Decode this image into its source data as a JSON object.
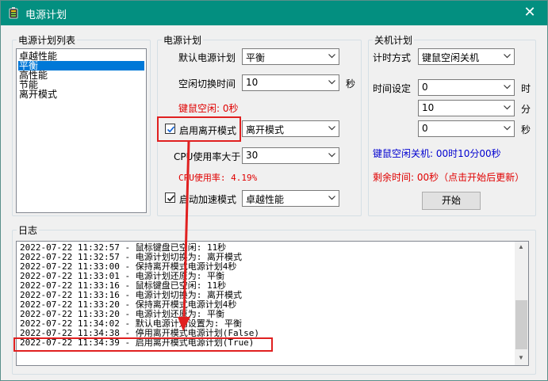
{
  "window": {
    "title": "电源计划",
    "close_glyph": "✕"
  },
  "plan_list": {
    "legend": "电源计划列表",
    "items": [
      "卓越性能",
      "平衡",
      "高性能",
      "节能",
      "离开模式"
    ],
    "selected_index": 1
  },
  "power_plan": {
    "legend": "电源计划",
    "default_label": "默认电源计划",
    "default_value": "平衡",
    "idle_switch_label": "空闲切换时间",
    "idle_switch_value": "10",
    "idle_switch_unit": "秒",
    "idle_status": "键鼠空闲: 0秒",
    "enable_away_label": "启用离开模式",
    "enable_away_checked": true,
    "away_value": "离开模式",
    "cpu_label": "CPU使用率大于",
    "cpu_value": "30",
    "cpu_status": "CPU使用率: 4.19%",
    "boost_label": "启动加速模式",
    "boost_checked": true,
    "boost_value": "卓越性能"
  },
  "shutdown": {
    "legend": "关机计划",
    "timer_label": "计时方式",
    "timer_value": "键鼠空闲关机",
    "time_label": "时间设定",
    "hours_value": "0",
    "hours_unit": "时",
    "minutes_value": "10",
    "minutes_unit": "分",
    "seconds_value": "0",
    "seconds_unit": "秒",
    "idle_shutdown": "键鼠空闲关机: 00时10分00秒",
    "remaining": "剩余时间: 00秒（点击开始后更新）",
    "start_label": "开始"
  },
  "log": {
    "legend": "日志",
    "lines": [
      "2022-07-22 11:32:57 - 鼠标键盘已空闲: 11秒",
      "2022-07-22 11:32:57 - 电源计划切换为: 离开模式",
      "2022-07-22 11:33:00 - 保持离开模式电源计划4秒",
      "2022-07-22 11:33:01 - 电源计划还原为: 平衡",
      "2022-07-22 11:33:16 - 鼠标键盘已空闲: 11秒",
      "2022-07-22 11:33:16 - 电源计划切换为: 离开模式",
      "2022-07-22 11:33:20 - 保持离开模式电源计划4秒",
      "2022-07-22 11:33:20 - 电源计划还原为: 平衡",
      "2022-07-22 11:34:02 - 默认电源计划设置为: 平衡",
      "2022-07-22 11:34:38 - 停用离开模式电源计划(False)",
      "2022-07-22 11:34:39 - 启用离开模式电源计划(True)"
    ],
    "scroll_up_glyph": "▲",
    "scroll_down_glyph": "▼"
  },
  "colors": {
    "titlebar": "#038f80",
    "selection": "#0078d7",
    "status_red": "#e00000",
    "status_blue": "#0000d0",
    "annotation_red": "#e02020"
  },
  "icons": {
    "app": "battery-app-icon",
    "close": "close-icon",
    "dropdown": "chevron-down-icon",
    "check": "checkmark-icon"
  }
}
